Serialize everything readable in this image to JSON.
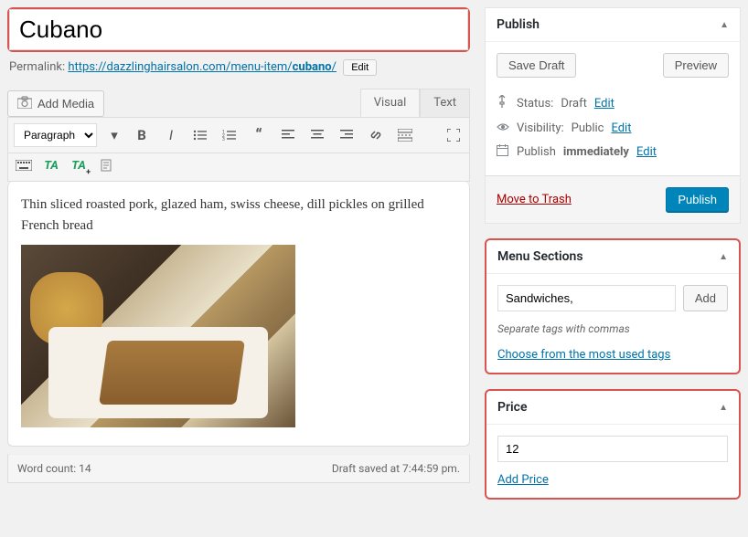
{
  "title_input": "Cubano",
  "permalink": {
    "label": "Permalink:",
    "base": "https://dazzlinghairsalon.com/menu-item/",
    "slug": "cubano",
    "trail": "/",
    "edit": "Edit"
  },
  "add_media": "Add Media",
  "tabs": {
    "visual": "Visual",
    "text": "Text"
  },
  "format_select": "Paragraph",
  "editor_content": "Thin sliced roasted pork, glazed ham, swiss cheese, dill pickles on grilled French bread",
  "status_bar": {
    "word_count_label": "Word count: 14",
    "saved": "Draft saved at 7:44:59 pm."
  },
  "publish": {
    "title": "Publish",
    "save_draft": "Save Draft",
    "preview": "Preview",
    "status_label": "Status:",
    "status_value": "Draft",
    "visibility_label": "Visibility:",
    "visibility_value": "Public",
    "schedule_label": "Publish",
    "schedule_value": "immediately",
    "edit": "Edit",
    "trash": "Move to Trash",
    "publish_btn": "Publish"
  },
  "menu_sections": {
    "title": "Menu Sections",
    "input_value": "Sandwiches,",
    "add": "Add",
    "hint": "Separate tags with commas",
    "choose_link": "Choose from the most used tags"
  },
  "price": {
    "title": "Price",
    "value": "12",
    "add_link": "Add Price"
  }
}
